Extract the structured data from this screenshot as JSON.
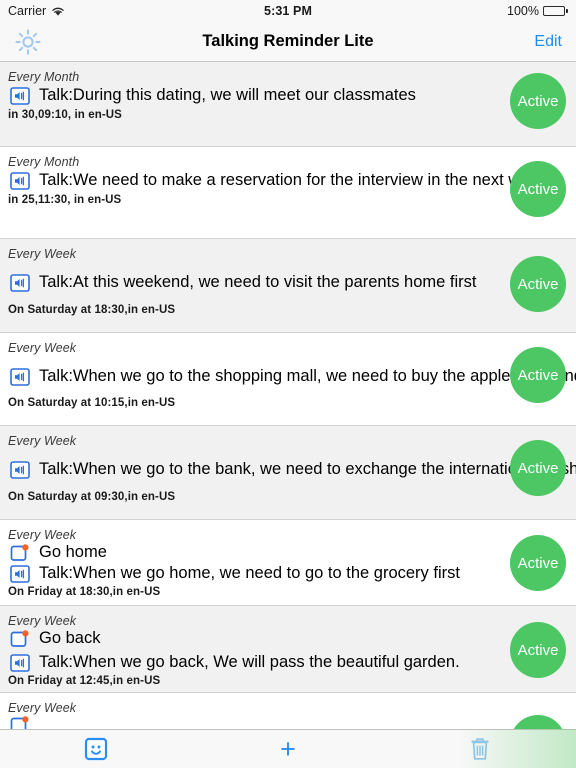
{
  "status_bar": {
    "carrier": "Carrier",
    "wifi_icon": "wifi-icon",
    "time": "5:31 PM",
    "battery_percent": "100%",
    "battery_icon": "battery-full-icon"
  },
  "nav_bar": {
    "settings_icon": "gear-icon",
    "title": "Talking Reminder Lite",
    "edit_label": "Edit"
  },
  "colors": {
    "accent_blue": "#1b8cf4",
    "active_green": "#4cc764",
    "badge_orange": "#f4622a",
    "row_alt_bg": "#f1f1f1"
  },
  "badge_label": "Active",
  "reminders": [
    {
      "repeat": "Every Month",
      "title": null,
      "talk": "Talk:During this dating, we will meet our classmates",
      "schedule": "in 30,09:10, in en-US",
      "status": "Active",
      "speaker_icon": "speaker-icon"
    },
    {
      "repeat": "Every Month",
      "title": null,
      "talk": "Talk:We need to make a reservation for the interview in the next week",
      "schedule": "in 25,11:30, in en-US",
      "status": "Active",
      "speaker_icon": "speaker-icon"
    },
    {
      "repeat": "Every Week",
      "title": null,
      "talk": "Talk:At this weekend, we need to visit the parents home first",
      "schedule": "On Saturday at 18:30,in en-US",
      "status": "Active",
      "speaker_icon": "speaker-icon"
    },
    {
      "repeat": "Every Week",
      "title": null,
      "talk": "Talk:When we go to the shopping mall, we need to buy the apple , rice and vegetables",
      "schedule": "On Saturday at 10:15,in en-US",
      "status": "Active",
      "speaker_icon": "speaker-icon"
    },
    {
      "repeat": "Every Week",
      "title": null,
      "talk": "Talk:When we go to the bank, we need to exchange the international cash in the bank",
      "schedule": "On Saturday at 09:30,in en-US",
      "status": "Active",
      "speaker_icon": "speaker-icon"
    },
    {
      "repeat": "Every Week",
      "title": "Go home",
      "talk": "Talk:When we go home, we need to go to the grocery first",
      "schedule": "On Friday at 18:30,in en-US",
      "status": "Active",
      "speaker_icon": "speaker-icon",
      "title_icon": "reminder-badge-icon"
    },
    {
      "repeat": "Every Week",
      "title": "Go back",
      "talk": "Talk:When we go back, We will pass the beautiful garden.",
      "schedule": "On Friday at 12:45,in en-US",
      "status": "Active",
      "speaker_icon": "speaker-icon",
      "title_icon": "reminder-badge-icon"
    },
    {
      "repeat": "Every Week",
      "title": null,
      "talk": null,
      "schedule": null,
      "status": "Active",
      "title_icon": "reminder-badge-icon"
    }
  ],
  "toolbar": {
    "face_label": "face-button",
    "add_label": "+",
    "delete_label": "delete-button"
  }
}
